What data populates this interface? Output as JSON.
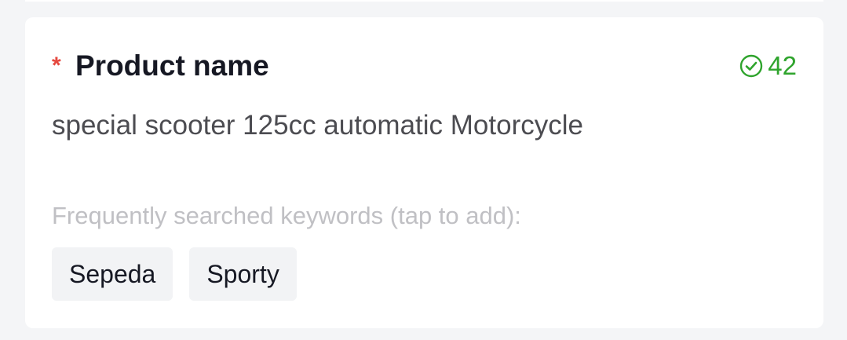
{
  "field": {
    "required_mark": "*",
    "label": "Product name",
    "char_count": "42",
    "value": "special scooter 125cc automatic Motorcycle"
  },
  "keywords": {
    "hint": "Frequently searched keywords (tap to add):",
    "chips": [
      {
        "label": "Sepeda"
      },
      {
        "label": "Sporty"
      }
    ]
  },
  "colors": {
    "required": "#e5483f",
    "success": "#2fa42d",
    "label": "#161823",
    "hint": "#c0c0c4",
    "background": "#f4f5f7"
  },
  "icons": {
    "char_count_icon": "check-circle-icon"
  }
}
